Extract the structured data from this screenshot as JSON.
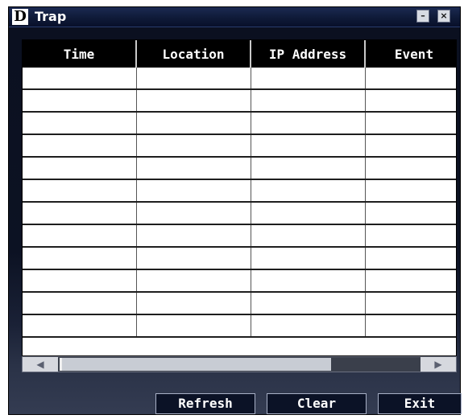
{
  "window": {
    "title": "Trap",
    "logo_text": "D",
    "minimize_label": "–",
    "close_label": "×"
  },
  "table": {
    "columns": [
      "Time",
      "Location",
      "IP Address",
      "Event"
    ],
    "rows": [
      [
        "",
        "",
        "",
        ""
      ],
      [
        "",
        "",
        "",
        ""
      ],
      [
        "",
        "",
        "",
        ""
      ],
      [
        "",
        "",
        "",
        ""
      ],
      [
        "",
        "",
        "",
        ""
      ],
      [
        "",
        "",
        "",
        ""
      ],
      [
        "",
        "",
        "",
        ""
      ],
      [
        "",
        "",
        "",
        ""
      ],
      [
        "",
        "",
        "",
        ""
      ],
      [
        "",
        "",
        "",
        ""
      ],
      [
        "",
        "",
        "",
        ""
      ],
      [
        "",
        "",
        "",
        ""
      ]
    ]
  },
  "scrollbar": {
    "left_icon": "◀",
    "right_icon": "▶"
  },
  "buttons": {
    "refresh": "Refresh",
    "clear": "Clear",
    "exit": "Exit"
  }
}
